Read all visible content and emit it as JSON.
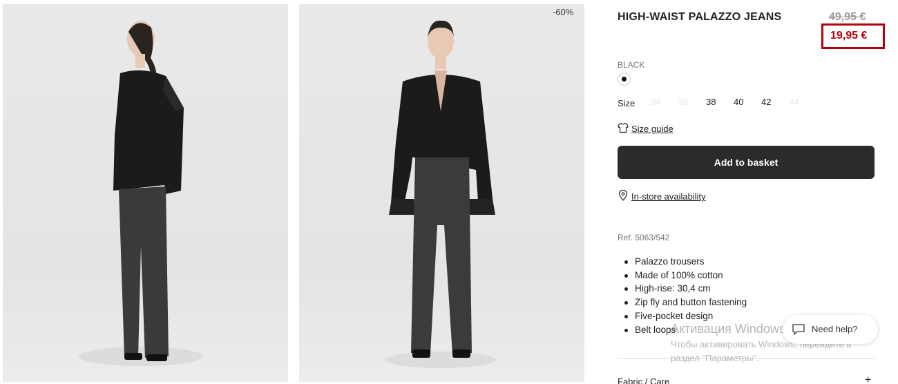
{
  "gallery": {
    "discount_badge": "-60%",
    "images": [
      {
        "alt": "side-view-photo"
      },
      {
        "alt": "front-view-photo"
      }
    ]
  },
  "product": {
    "title": "HIGH-WAIST PALAZZO JEANS",
    "old_price": "49,95 €",
    "new_price": "19,95 €",
    "color_name": "BLACK",
    "size_label": "Size",
    "sizes": [
      {
        "label": "34",
        "available": false
      },
      {
        "label": "36",
        "available": false
      },
      {
        "label": "38",
        "available": true
      },
      {
        "label": "40",
        "available": true
      },
      {
        "label": "42",
        "available": true
      },
      {
        "label": "44",
        "available": false
      }
    ],
    "size_guide_label": "Size guide",
    "add_to_basket_label": "Add to basket",
    "instore_label": "In-store availability",
    "ref": "Ref. 5063/542",
    "features": [
      "Palazzo trousers",
      "Made of 100% cotton",
      "High-rise: 30,4 cm",
      "Zip fly and button fastening",
      "Five-pocket design",
      "Belt loops"
    ],
    "fabric_care_label": "Fabric / Care",
    "fabric_care_toggle": "+"
  },
  "help": {
    "label": "Need help?"
  },
  "windows_watermark": {
    "line1": "Активация Windows",
    "line2": "Чтобы активировать Windows, перейдите в",
    "line3": "раздел \"Параметры\"."
  },
  "colors": {
    "accent_price": "#b3000c",
    "button_bg": "#2b2b2b"
  },
  "icons": [
    "tshirt-icon",
    "map-pin-icon",
    "chat-bubble-icon"
  ]
}
